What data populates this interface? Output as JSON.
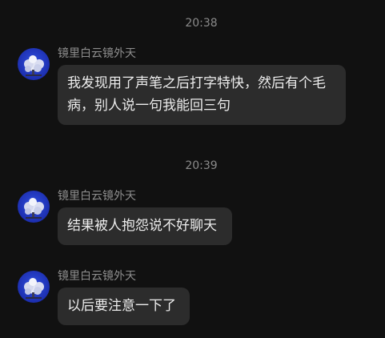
{
  "timestamps": [
    "20:38",
    "20:39"
  ],
  "messages": [
    {
      "sender": "镜里白云镜外天",
      "text": "我发现用了声笔之后打字特快，然后有个毛病，别人说一句我能回三句"
    },
    {
      "sender": "镜里白云镜外天",
      "text": "结果被人抱怨说不好聊天"
    },
    {
      "sender": "镜里白云镜外天",
      "text": "以后要注意一下了"
    }
  ],
  "colors": {
    "background": "#111111",
    "bubble": "#2c2c2c",
    "bubble_text": "#ececec",
    "meta_text": "#8a8a8a"
  }
}
